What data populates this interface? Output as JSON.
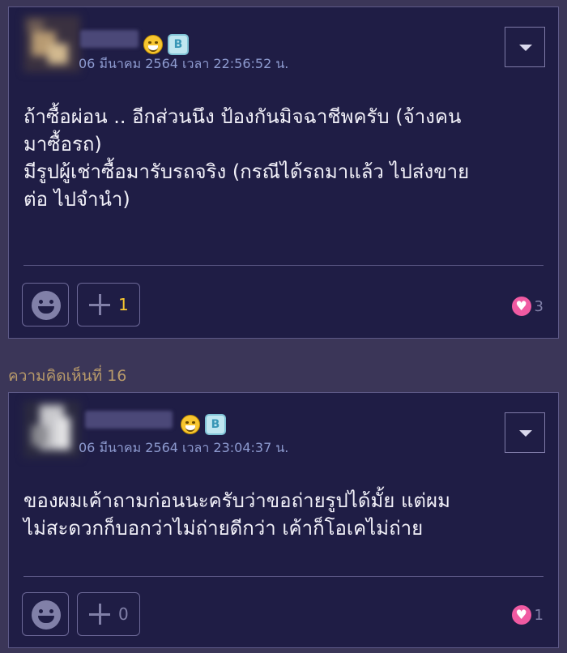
{
  "colors": {
    "page_bg": "#3b3658",
    "card_bg": "#1f1d45",
    "timestamp": "#8e9bd0",
    "section_label": "#b89a6a",
    "heart": "#f05aa2",
    "plus_active": "#f7c630"
  },
  "comment15": {
    "timestamp": "06 มีนาคม 2564 เวลา 22:56:52 น.",
    "badge_letter": "B",
    "lines": [
      "ถ้าซื้อผ่อน .. อีกส่วนนึง ป้องกันมิจฉาชีพครับ (จ้างคน",
      "มาซื้อรถ)",
      "มีรูปผู้เช่าซื้อมารับรถจริง (กรณีได้รถมาแล้ว ไปส่งขาย",
      "ต่อ ไปจำนำ)"
    ],
    "plus_count": "1",
    "heart_count": "3"
  },
  "section_label": "ความคิดเห็นที่ 16",
  "comment16": {
    "timestamp": "06 มีนาคม 2564 เวลา 23:04:37 น.",
    "badge_letter": "B",
    "lines": [
      "ของผมเค้าถามก่อนนะครับว่าขอถ่ายรูปได้มั้ย แต่ผม",
      "ไม่สะดวกก็บอกว่าไม่ถ่ายดีกว่า เค้าก็โอเคไม่ถ่าย"
    ],
    "plus_count": "0",
    "heart_count": "1"
  }
}
